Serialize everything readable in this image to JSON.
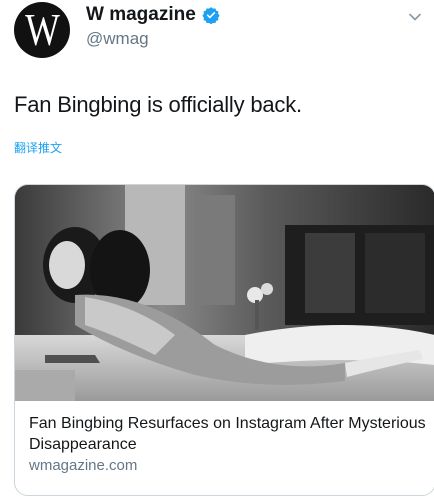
{
  "tweet": {
    "display_name": "W magazine",
    "handle": "@wmag",
    "avatar_letter": "W",
    "verified": true,
    "text": "Fan Bingbing is officially back.",
    "translate_label": "翻译推文",
    "icons": {
      "verified": "verified-badge-icon",
      "caret": "chevron-down-icon"
    },
    "colors": {
      "link": "#1da1f2",
      "secondary": "#657786",
      "primary_text": "#14171a",
      "verified": "#1da1f2"
    }
  },
  "card": {
    "title": "Fan Bingbing Resurfaces on Instagram After Mysterious Disappearance",
    "domain": "wmagazine.com"
  }
}
